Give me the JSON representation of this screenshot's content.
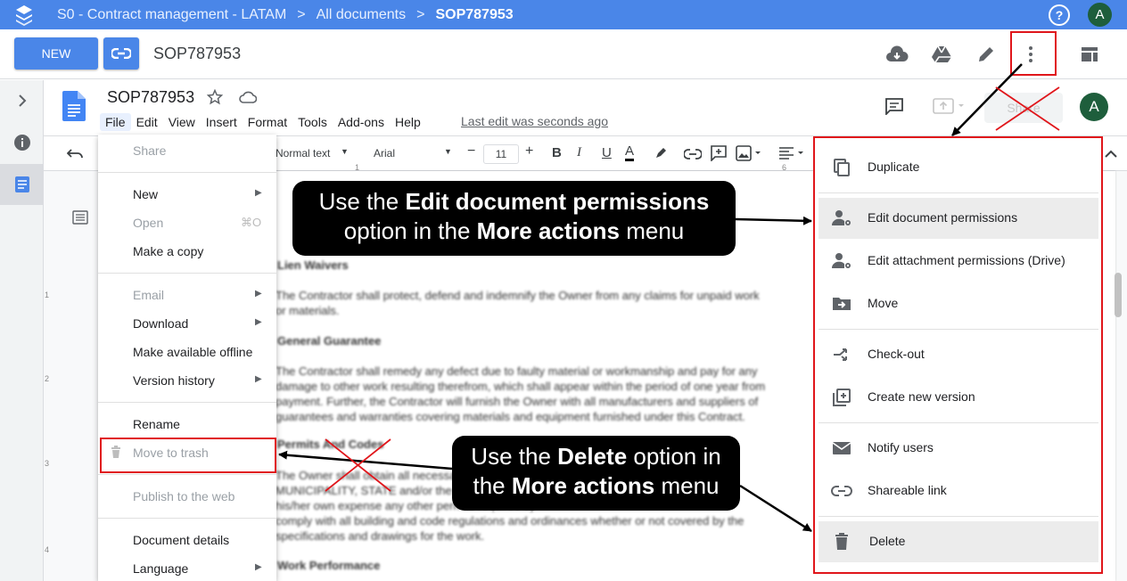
{
  "breadcrumb": {
    "items": [
      "S0 - Contract management - LATAM",
      "All documents",
      "SOP787953"
    ],
    "separator": ">"
  },
  "topbar": {
    "help_icon": "help-circle-icon",
    "avatar_letter": "A"
  },
  "actionbar": {
    "new_label": "NEW",
    "doc_title": "SOP787953",
    "icons": [
      "link-icon",
      "cloud-download-icon",
      "google-drive-icon",
      "pencil-icon",
      "more-vert-icon",
      "layout-icon"
    ]
  },
  "docs": {
    "title": "SOP787953",
    "menu": [
      "File",
      "Edit",
      "View",
      "Insert",
      "Format",
      "Tools",
      "Add-ons",
      "Help"
    ],
    "last_edit": "Last edit was seconds ago",
    "share_label": "Share",
    "avatar_letter": "A"
  },
  "toolbar": {
    "style": "Normal text",
    "font": "Arial",
    "size": "11",
    "ruler_ticks": [
      "1",
      "6"
    ]
  },
  "doc_body": {
    "lines": [
      "Lien Waivers",
      "The Contractor shall protect, defend and indemnify the Owner from any claims for unpaid work",
      "or materials.",
      "General Guarantee",
      "The Contractor shall remedy any defect due to faulty material or workmanship and pay for any",
      "damage to other work resulting therefrom, which shall appear within the period of one year from",
      "payment.  Further, the Contractor will furnish the Owner with all manufacturers and suppliers of",
      "guarantees and warranties covering materials and equipment furnished under this Contract.",
      "Permits And Codes",
      "The Owner shall obtain all necessary permits for the",
      "MUNICIPALITY, STATE and/or the State, the Contractor shall secure",
      "his/her own expense any other permits required by",
      "comply with all building and code regulations and ordinances whether or not covered by the",
      "specifications and drawings for the work.",
      "Work Performance"
    ],
    "vertical_ruler": [
      "1",
      "2",
      "3",
      "4"
    ]
  },
  "file_menu": {
    "items": [
      {
        "label": "Share",
        "disabled": true
      },
      {
        "label": "New",
        "submenu": true
      },
      {
        "label": "Open",
        "disabled": true,
        "shortcut": "⌘O"
      },
      {
        "label": "Make a copy"
      },
      {
        "label": "Email",
        "disabled": true,
        "submenu": true
      },
      {
        "label": "Download",
        "submenu": true
      },
      {
        "label": "Make available offline"
      },
      {
        "label": "Version history",
        "submenu": true
      },
      {
        "label": "Rename"
      },
      {
        "label": "Move to trash",
        "disabled": true
      },
      {
        "label": "Publish to the web",
        "disabled": true
      },
      {
        "label": "Document details"
      },
      {
        "label": "Language",
        "submenu": true
      }
    ]
  },
  "more_actions_menu": {
    "items": [
      {
        "label": "Duplicate",
        "icon": "copy-icon"
      },
      {
        "label": "Edit document permissions",
        "icon": "manage-accounts-icon",
        "highlighted": true
      },
      {
        "label": "Edit attachment permissions (Drive)",
        "icon": "manage-accounts-icon"
      },
      {
        "label": "Move",
        "icon": "drive-file-move-icon"
      },
      {
        "label": "Check-out",
        "icon": "call-split-icon"
      },
      {
        "label": "Create new version",
        "icon": "library-add-icon"
      },
      {
        "label": "Notify users",
        "icon": "email-icon"
      },
      {
        "label": "Shareable link",
        "icon": "link-icon"
      },
      {
        "label": "Delete",
        "icon": "delete-icon",
        "highlighted": true
      }
    ]
  },
  "callouts": {
    "top": {
      "line1_pre": "Use the ",
      "line1_bold": "Edit document permissions",
      "line2_pre": "option in the ",
      "line2_bold": "More actions",
      "line2_post": " menu"
    },
    "bottom": {
      "line1_pre": "Use the ",
      "line1_bold": "Delete",
      "line1_post": " option in",
      "line2_pre": "the ",
      "line2_bold": "More actions",
      "line2_post": " menu"
    }
  },
  "colors": {
    "accent": "#4a86e8",
    "annotation_red": "#e0161b",
    "avatar": "#1e5e3c",
    "callout_bg": "#000000"
  }
}
